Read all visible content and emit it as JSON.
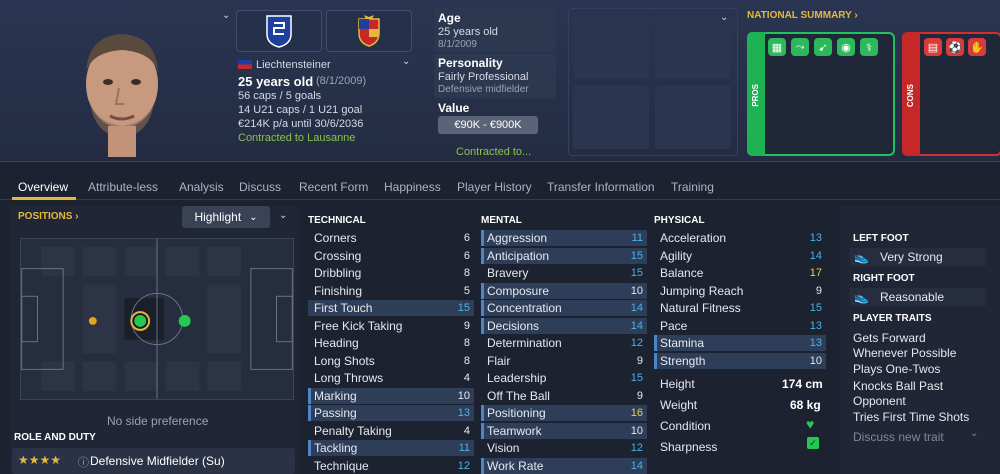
{
  "header": {
    "nationality": "Liechtensteiner",
    "age_line": "25 years old",
    "dob_paren": "(8/1/2009)",
    "caps": "56 caps / 5 goals",
    "u21_caps": "14 U21 caps / 1 U21 goal",
    "contract_wage": "€214K p/a until 30/6/2036",
    "contracted_to": "Contracted to Lausanne",
    "age_label": "Age",
    "age_value": "25 years old",
    "age_dob": "8/1/2009",
    "personality_label": "Personality",
    "personality_value": "Fairly Professional",
    "position_text": "Defensive midfielder",
    "value_label": "Value",
    "value_range": "€90K - €900K",
    "contracted_to_short": "Contracted to...",
    "national_summary": "NATIONAL SUMMARY ›",
    "pros_label": "PROS",
    "cons_label": "CONS"
  },
  "tabs": [
    "Overview",
    "Attribute-less",
    "Analysis",
    "Discuss",
    "Recent Form",
    "Happiness",
    "Player History",
    "Transfer Information",
    "Training"
  ],
  "left": {
    "positions_title": "POSITIONS ›",
    "highlight_label": "Highlight",
    "side_preference": "No side preference",
    "role_title": "ROLE AND DUTY",
    "role_value": "Defensive Midfielder (Su)",
    "role_stars": "★★★★"
  },
  "attributes": {
    "technical_title": "TECHNICAL",
    "mental_title": "MENTAL",
    "physical_title": "PHYSICAL",
    "technical": [
      {
        "name": "Corners",
        "value": "6"
      },
      {
        "name": "Crossing",
        "value": "6"
      },
      {
        "name": "Dribbling",
        "value": "8"
      },
      {
        "name": "Finishing",
        "value": "5"
      },
      {
        "name": "First Touch",
        "value": "15"
      },
      {
        "name": "Free Kick Taking",
        "value": "9"
      },
      {
        "name": "Heading",
        "value": "8"
      },
      {
        "name": "Long Shots",
        "value": "8"
      },
      {
        "name": "Long Throws",
        "value": "4"
      },
      {
        "name": "Marking",
        "value": "10"
      },
      {
        "name": "Passing",
        "value": "13"
      },
      {
        "name": "Penalty Taking",
        "value": "4"
      },
      {
        "name": "Tackling",
        "value": "11"
      },
      {
        "name": "Technique",
        "value": "12"
      }
    ],
    "mental": [
      {
        "name": "Aggression",
        "value": "11"
      },
      {
        "name": "Anticipation",
        "value": "15"
      },
      {
        "name": "Bravery",
        "value": "15"
      },
      {
        "name": "Composure",
        "value": "10"
      },
      {
        "name": "Concentration",
        "value": "14"
      },
      {
        "name": "Decisions",
        "value": "14"
      },
      {
        "name": "Determination",
        "value": "12"
      },
      {
        "name": "Flair",
        "value": "9"
      },
      {
        "name": "Leadership",
        "value": "15"
      },
      {
        "name": "Off The Ball",
        "value": "9"
      },
      {
        "name": "Positioning",
        "value": "16"
      },
      {
        "name": "Teamwork",
        "value": "10"
      },
      {
        "name": "Vision",
        "value": "12"
      },
      {
        "name": "Work Rate",
        "value": "14"
      }
    ],
    "physical": [
      {
        "name": "Acceleration",
        "value": "13"
      },
      {
        "name": "Agility",
        "value": "14"
      },
      {
        "name": "Balance",
        "value": "17"
      },
      {
        "name": "Jumping Reach",
        "value": "9"
      },
      {
        "name": "Natural Fitness",
        "value": "15"
      },
      {
        "name": "Pace",
        "value": "13"
      },
      {
        "name": "Stamina",
        "value": "13"
      },
      {
        "name": "Strength",
        "value": "10"
      }
    ],
    "height_label": "Height",
    "height_value": "174 cm",
    "weight_label": "Weight",
    "weight_value": "68 kg",
    "condition_label": "Condition",
    "sharpness_label": "Sharpness"
  },
  "right": {
    "left_foot_title": "LEFT FOOT",
    "left_foot_value": "Very Strong",
    "right_foot_title": "RIGHT FOOT",
    "right_foot_value": "Reasonable",
    "traits_title": "PLAYER TRAITS",
    "traits": [
      "Gets Forward Whenever Possible",
      "Plays One-Twos",
      "Knocks Ball Past Opponent",
      "Tries First Time Shots"
    ],
    "discuss_trait": "Discuss new trait"
  }
}
